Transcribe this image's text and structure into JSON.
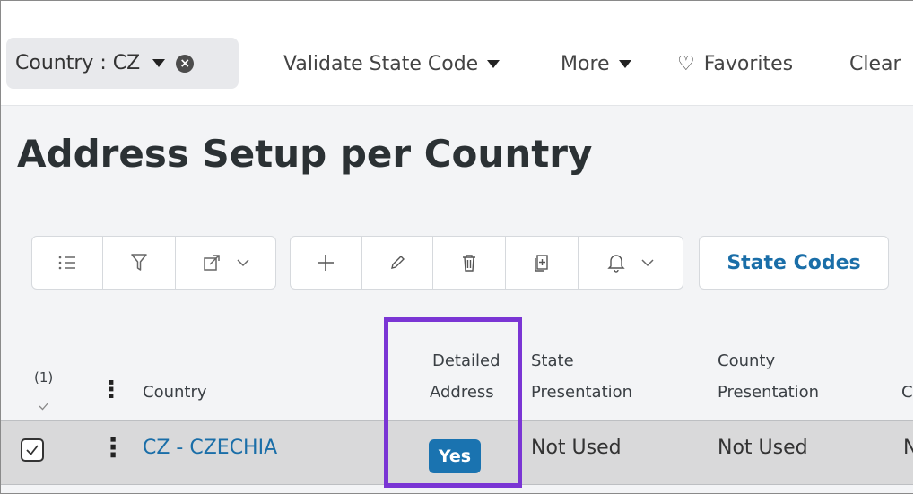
{
  "filter": {
    "label": "Country : CZ"
  },
  "commands": {
    "validate_state_code": "Validate State Code",
    "more": "More",
    "favorites": "Favorites",
    "clear": "Clear"
  },
  "page": {
    "title": "Address Setup per Country"
  },
  "toolbar": {
    "state_codes": "State Codes"
  },
  "table": {
    "selection_count": "(1)",
    "headers": {
      "country": "Country",
      "detailed_address_1": "Detailed",
      "detailed_address_2": "Address",
      "state_presentation_1": "State",
      "state_presentation_2": "Presentation",
      "county_presentation_1": "County",
      "county_presentation_2": "Presentation",
      "next_partial": "C"
    },
    "rows": [
      {
        "country": "CZ - CZECHIA",
        "detailed_address": "Yes",
        "state_presentation": "Not Used",
        "county_presentation": "Not Used",
        "next_partial": "N"
      }
    ]
  },
  "colors": {
    "link": "#1a6ea8",
    "badge": "#1a73b0",
    "highlight": "#7a35d4"
  }
}
